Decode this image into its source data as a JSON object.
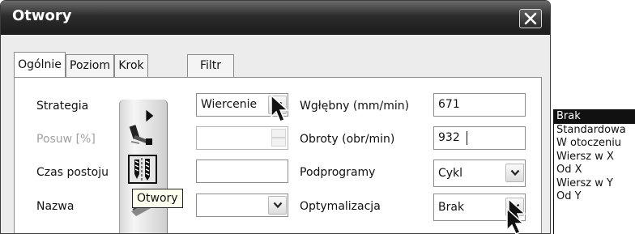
{
  "window": {
    "title": "Otwory"
  },
  "tabs": [
    {
      "label": "Ogólnie",
      "active": true
    },
    {
      "label": "Poziom",
      "active": false
    },
    {
      "label": "Krok",
      "active": false
    },
    {
      "label": "Filtr",
      "active": false
    }
  ],
  "form": {
    "strategy": {
      "label": "Strategia",
      "value": "Wiercenie"
    },
    "feed": {
      "label": "Posuw [%]",
      "value": ""
    },
    "dwell": {
      "label": "Czas postoju",
      "value": ""
    },
    "name": {
      "label": "Nazwa",
      "value": ""
    },
    "depth": {
      "label": "Wgłębny (mm/min)",
      "value": "671"
    },
    "speed": {
      "label": "Obroty (obr/min)",
      "value": "932"
    },
    "subprograms": {
      "label": "Podprogramy",
      "value": "Cykl"
    },
    "optimization": {
      "label": "Optymalizacja",
      "value": "Brak"
    }
  },
  "toolbar": {
    "tooltip": "Otwory"
  },
  "optimization_list": {
    "items": [
      "Brak",
      "Standardowa",
      "W otoczeniu",
      "Wiersz w X",
      "Od X",
      "Wiersz w Y",
      "Od Y"
    ],
    "selected": "Brak"
  },
  "icons": {
    "close": "close-icon",
    "dropdown": "chevron-down-icon",
    "spinner": "spinner-icon",
    "toolbar": [
      "expand-arrow-icon",
      "drill-tool-icon",
      "drill-holes-icon",
      "tool-icon"
    ],
    "pointer": "mouse-pointer-icon"
  }
}
